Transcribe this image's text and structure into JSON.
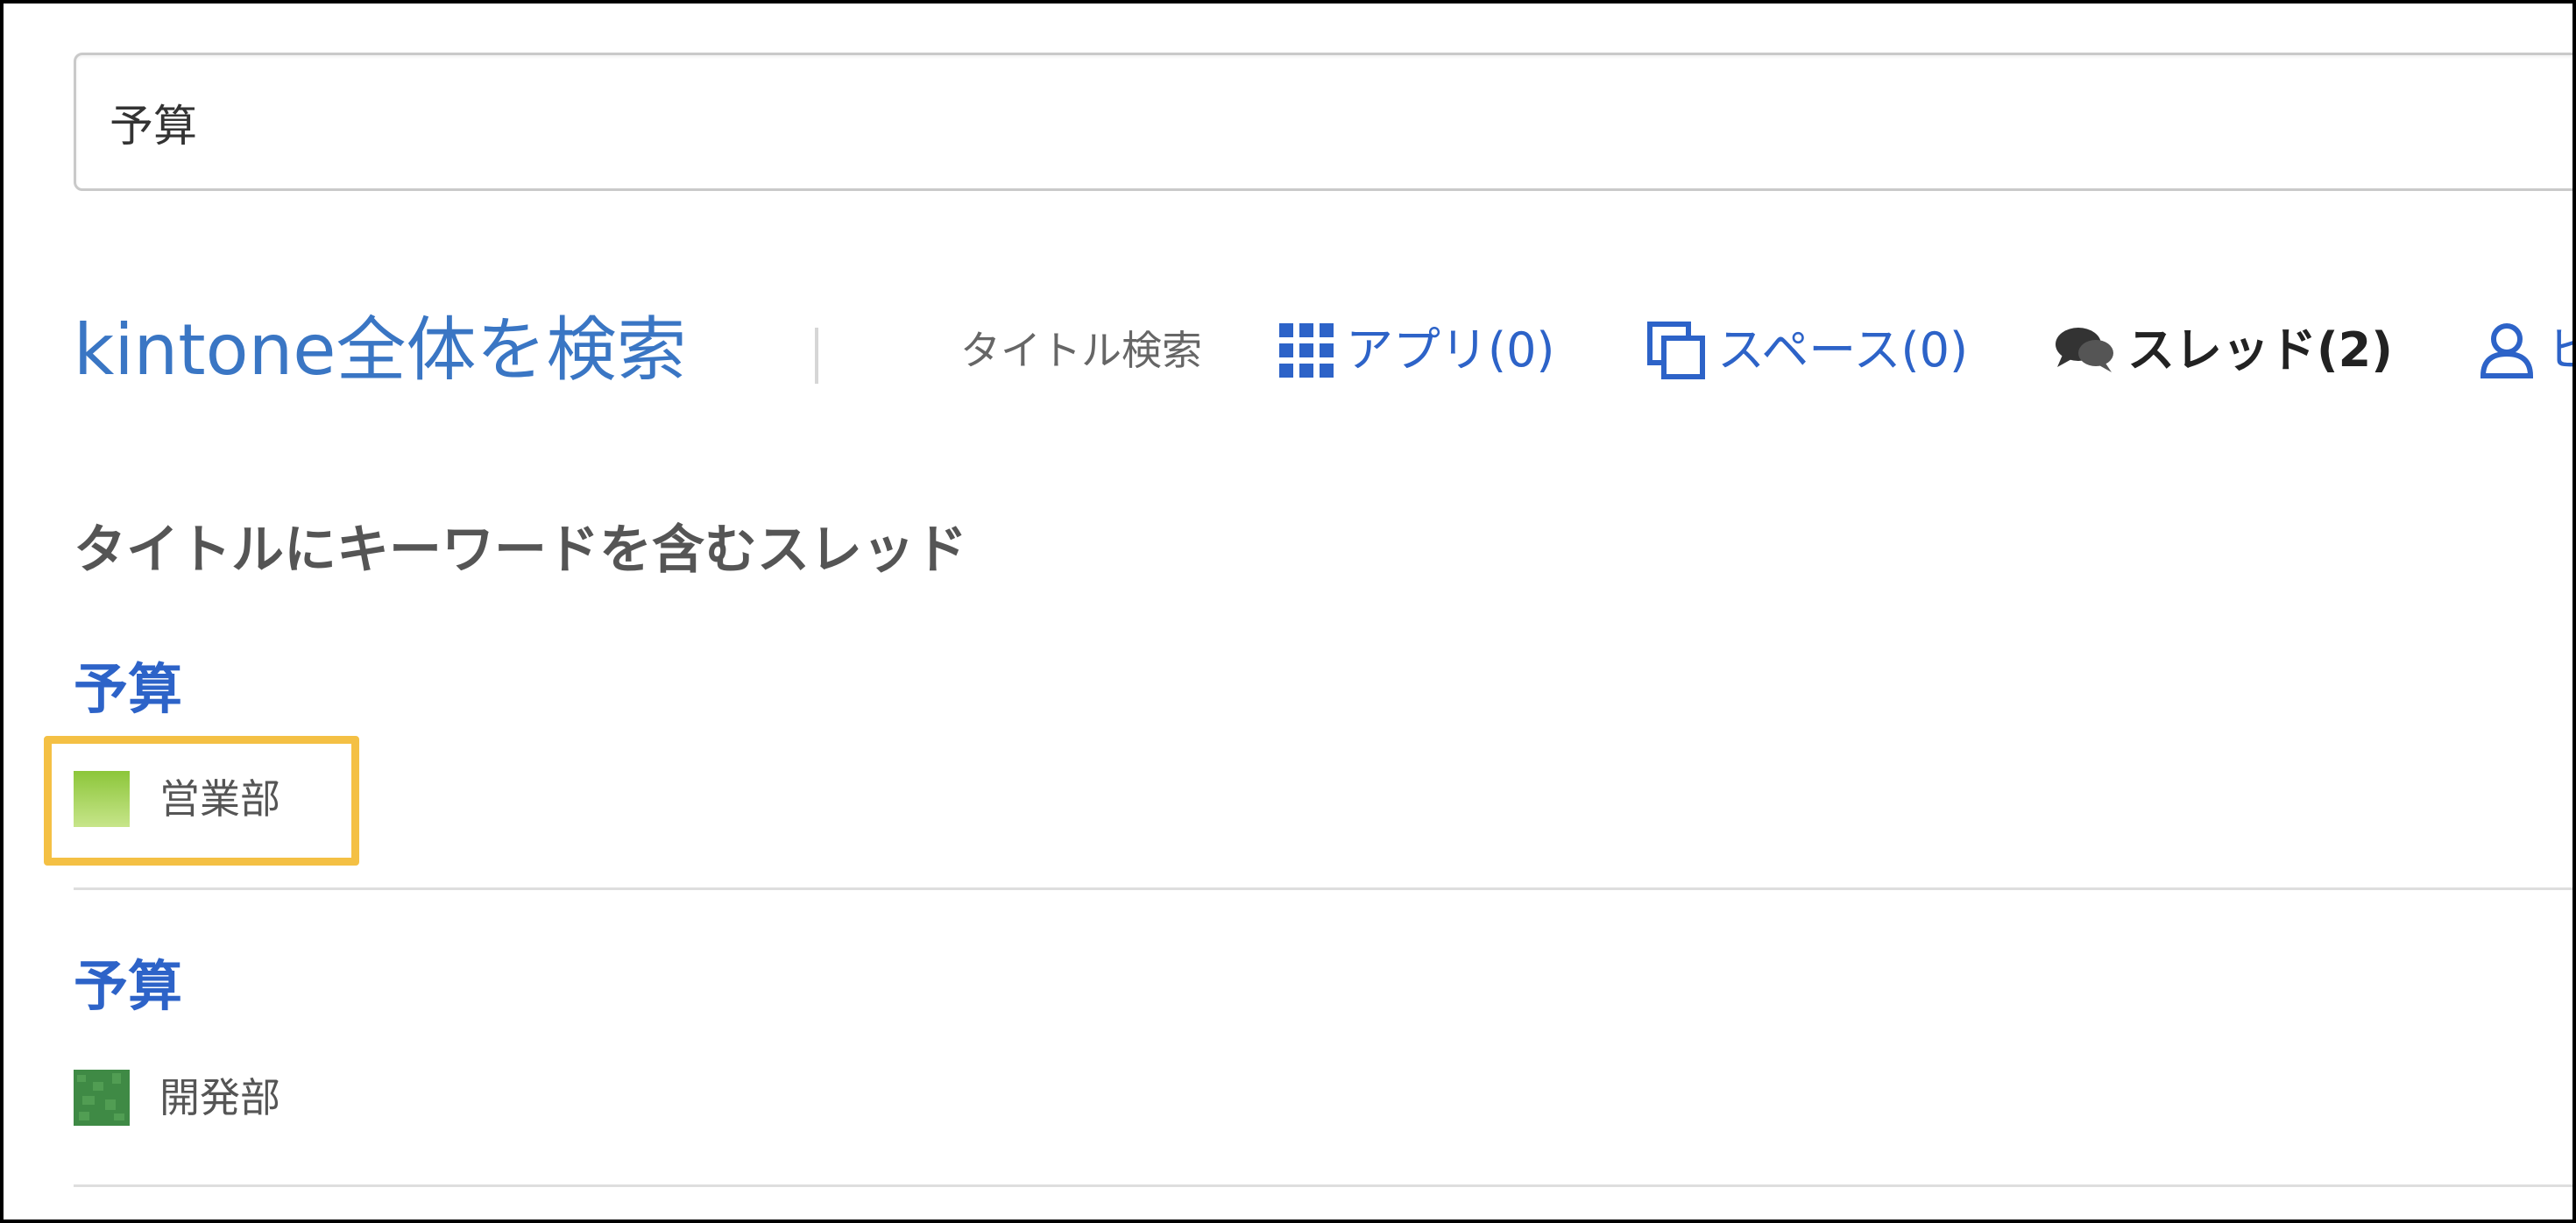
{
  "search": {
    "value": "予算"
  },
  "header": {
    "scope_title": "kintone全体を検索",
    "title_search_label": "タイトル検索",
    "tabs": [
      {
        "label": "アプリ(0)",
        "icon": "grid-icon"
      },
      {
        "label": "スペース(0)",
        "icon": "stacked-squares-icon"
      },
      {
        "label": "スレッド(2)",
        "icon": "speech-bubbles-icon",
        "active": true
      },
      {
        "label": "ヒ",
        "icon": "user-icon"
      }
    ]
  },
  "section": {
    "heading": "タイトルにキーワードを含むスレッド"
  },
  "results": [
    {
      "title": "予算",
      "space": "営業部",
      "space_color": "#9acd3c",
      "highlighted": true
    },
    {
      "title": "予算",
      "space": "開発部",
      "space_color": "#3f8a45",
      "highlighted": false
    }
  ],
  "colors": {
    "link": "#2d63c8",
    "highlight": "#f4c044"
  }
}
